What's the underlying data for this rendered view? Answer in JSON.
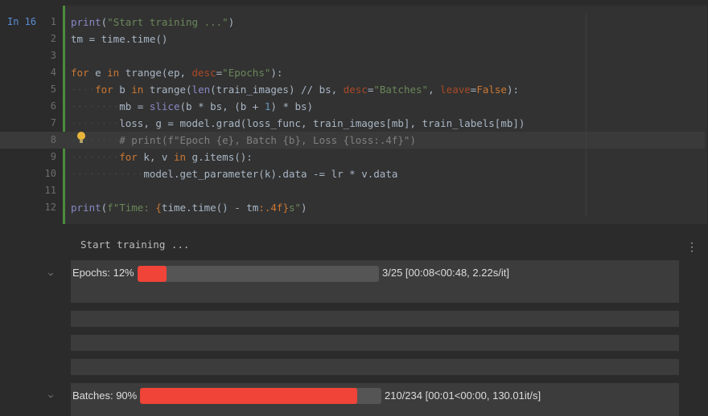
{
  "cell": {
    "label": "In 16"
  },
  "editor": {
    "line_numbers": [
      "1",
      "2",
      "3",
      "4",
      "5",
      "6",
      "7",
      "8",
      "9",
      "10",
      "11",
      "12"
    ]
  },
  "output": {
    "stdout": "Start training ...",
    "epochs": {
      "label": "Epochs: 12%",
      "stats": "3/25 [00:08<00:48, 2.22s/it]",
      "progress": 0.12
    },
    "batches": {
      "label": "Batches: 90%",
      "stats": "210/234 [00:01<00:00, 130.01it/s]",
      "progress": 0.9
    }
  },
  "icons": {
    "collapse": "chevron-down-icon",
    "menu": "vertical-ellipsis-icon",
    "hint": "lightbulb-icon"
  },
  "colors": {
    "accent_bar": "#4e8a3e",
    "progress_fill": "#f04438",
    "cell_label": "#5a8dd6"
  }
}
